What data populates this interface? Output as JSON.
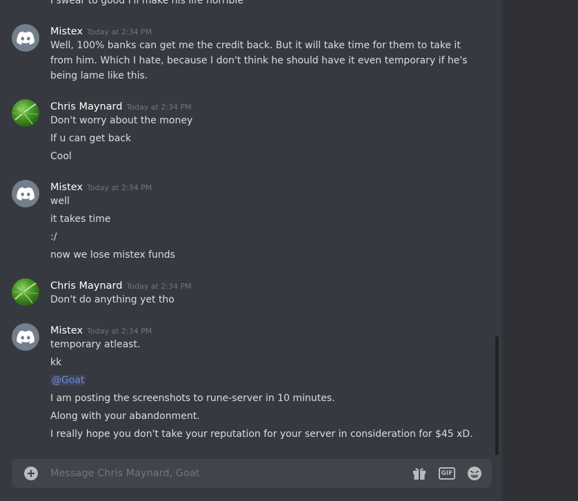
{
  "partial_top_line": "I swear to good I'll make his life horrible",
  "messages": [
    {
      "user": "Mistex",
      "avatar": "discord-logo-avatar",
      "time": "Today at 2:34 PM",
      "lines": [
        "Well, 100% banks can get me the credit back. But it will take time for them to take it",
        "from him. Which I hate, because I don't think he should have it even temporary if he's",
        "being lame like this."
      ]
    },
    {
      "user": "Chris Maynard",
      "avatar": "leaf-photo-avatar",
      "time": "Today at 2:34 PM",
      "lines": [
        "Don't worry about the money",
        "If u can get back",
        "Cool"
      ]
    },
    {
      "user": "Mistex",
      "avatar": "discord-logo-avatar",
      "time": "Today at 2:34 PM",
      "lines": [
        "well",
        "it takes time",
        ":/",
        "now we lose mistex funds"
      ]
    },
    {
      "user": "Chris Maynard",
      "avatar": "leaf-photo-avatar",
      "time": "Today at 2:34 PM",
      "lines": [
        "Don't do anything yet tho"
      ]
    },
    {
      "user": "Mistex",
      "avatar": "discord-logo-avatar",
      "time": "Today at 2:34 PM",
      "lines": [
        "temporary atleast.",
        "kk",
        "@Goat",
        "I am posting the screenshots to rune-server in 10 minutes.",
        "Along with your abandonment.",
        "I really hope you don't take your reputation for your server in consideration for $45 xD."
      ]
    }
  ],
  "composer": {
    "placeholder": "Message Chris Maynard, Goat",
    "gif_label": "GIF",
    "icons": [
      "add-icon",
      "gift-icon",
      "gif-icon",
      "emoji-icon"
    ]
  },
  "colors": {
    "background": "#36393f",
    "side_panel": "#2f3136",
    "composer": "#40444b",
    "mention": "#7289da",
    "timestamp": "#72767d"
  }
}
